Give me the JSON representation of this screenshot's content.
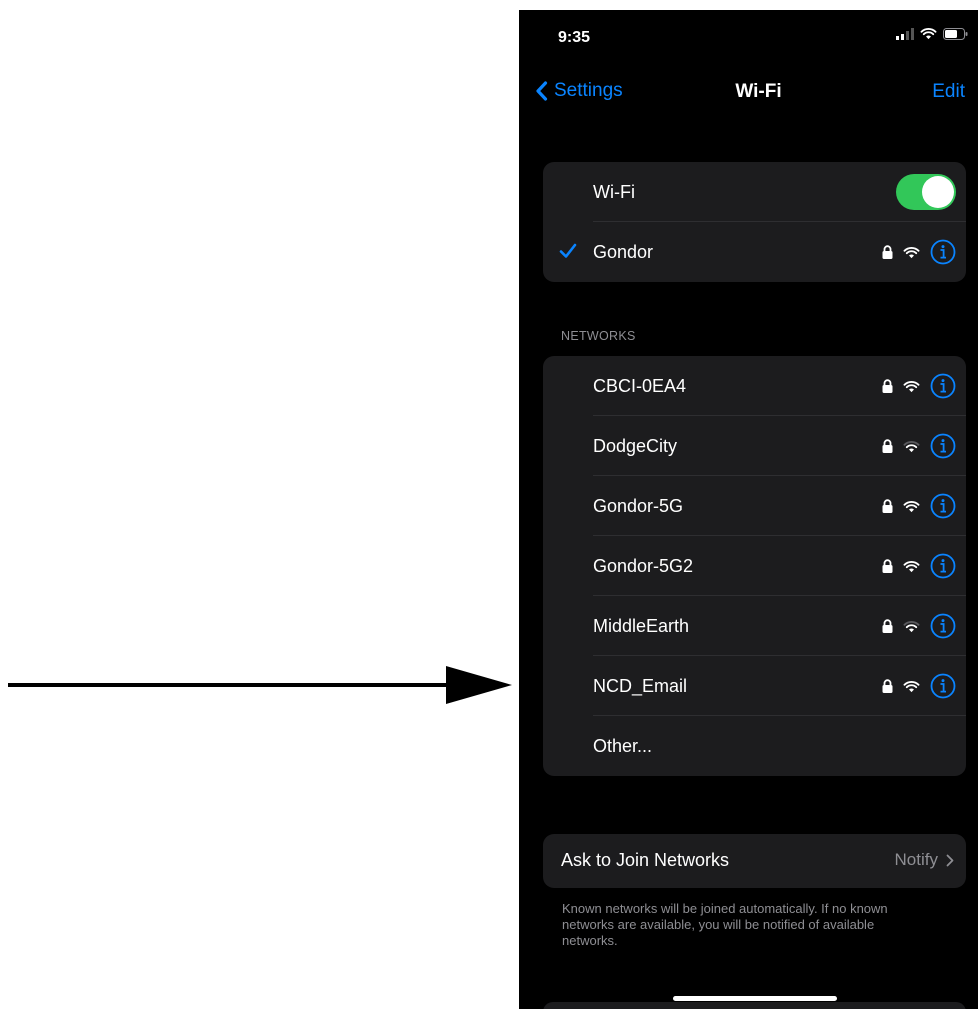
{
  "status_bar": {
    "time": "9:35"
  },
  "nav": {
    "back_label": "Settings",
    "title": "Wi-Fi",
    "edit_label": "Edit"
  },
  "wifi": {
    "label": "Wi-Fi",
    "enabled": true,
    "connected_network": "Gondor"
  },
  "networks": {
    "header": "NETWORKS",
    "items": [
      {
        "name": "CBCI-0EA4"
      },
      {
        "name": "DodgeCity"
      },
      {
        "name": "Gondor-5G"
      },
      {
        "name": "Gondor-5G2"
      },
      {
        "name": "MiddleEarth"
      },
      {
        "name": "NCD_Email"
      }
    ],
    "other_label": "Other..."
  },
  "ask_to_join": {
    "label": "Ask to Join Networks",
    "value": "Notify"
  },
  "footer_note": "Known networks will be joined automatically. If no known networks are available, you will be notified of available networks.",
  "colors": {
    "accent": "#0a84ff",
    "toggle_on": "#32c759",
    "card": "#1c1c1e",
    "background": "#000000"
  }
}
